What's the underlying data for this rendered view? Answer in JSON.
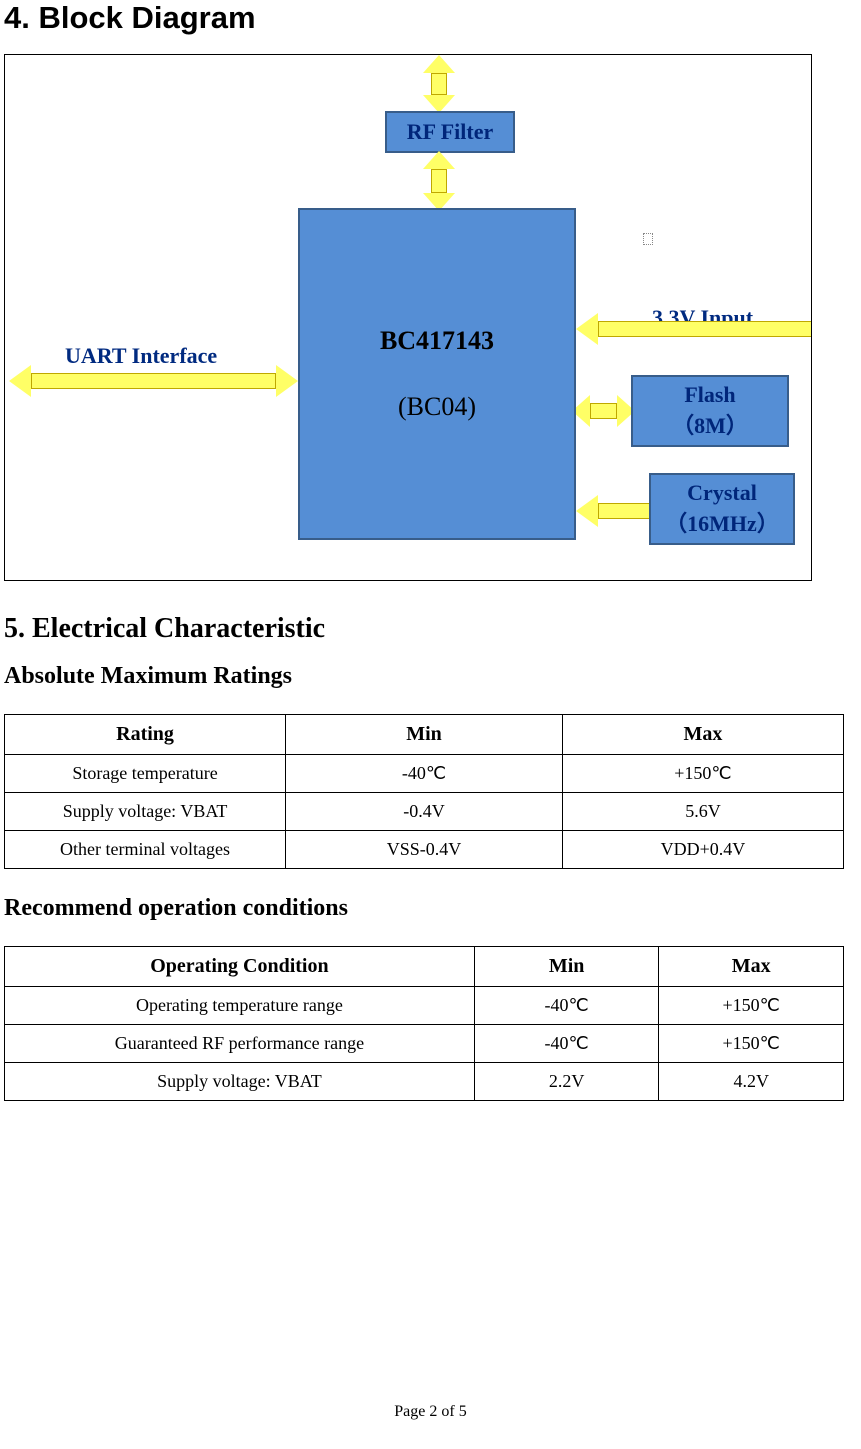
{
  "headings": {
    "block_diagram": "4. Block Diagram",
    "electrical": "5. Electrical Characteristic",
    "abs_max": "Absolute Maximum Ratings",
    "rec_op": "Recommend operation conditions"
  },
  "diagram": {
    "chip_line1": "BC417143",
    "chip_line2": "(BC04)",
    "rf_filter": "RF Filter",
    "flash_line1": "Flash",
    "flash_line2": "（8M）",
    "crystal_line1": "Crystal",
    "crystal_line2": "（16MHz）",
    "uart_label": "UART Interface",
    "vin_label": "3.3V Input"
  },
  "tables": {
    "abs_max": {
      "headers": [
        "Rating",
        "Min",
        "Max"
      ],
      "rows": [
        [
          "Storage temperature",
          "-40℃",
          "+150℃"
        ],
        [
          "Supply voltage: VBAT",
          "-0.4V",
          "5.6V"
        ],
        [
          "Other terminal voltages",
          "VSS-0.4V",
          "VDD+0.4V"
        ]
      ]
    },
    "rec_op": {
      "headers": [
        "Operating Condition",
        "Min",
        "Max"
      ],
      "col_widths": [
        "56%",
        "22%",
        "22%"
      ],
      "rows": [
        [
          "Operating temperature range",
          "-40℃",
          "+150℃"
        ],
        [
          "Guaranteed RF performance range",
          "-40℃",
          "+150℃"
        ],
        [
          "Supply voltage: VBAT",
          "2.2V",
          "4.2V"
        ]
      ]
    }
  },
  "footer": "Page 2 of 5"
}
